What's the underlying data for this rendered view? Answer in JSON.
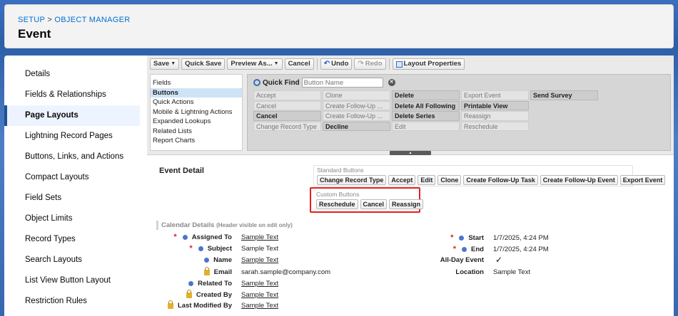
{
  "header": {
    "breadcrumb_setup": "SETUP",
    "breadcrumb_sep": " > ",
    "breadcrumb_object_manager": "OBJECT MANAGER",
    "title": "Event"
  },
  "sidebar": {
    "items": [
      {
        "label": "Details"
      },
      {
        "label": "Fields & Relationships"
      },
      {
        "label": "Page Layouts"
      },
      {
        "label": "Lightning Record Pages"
      },
      {
        "label": "Buttons, Links, and Actions"
      },
      {
        "label": "Compact Layouts"
      },
      {
        "label": "Field Sets"
      },
      {
        "label": "Object Limits"
      },
      {
        "label": "Record Types"
      },
      {
        "label": "Search Layouts"
      },
      {
        "label": "List View Button Layout"
      },
      {
        "label": "Restriction Rules"
      }
    ],
    "active_index": 2
  },
  "toolbar": {
    "save": "Save",
    "quick_save": "Quick Save",
    "preview_as": "Preview As...",
    "cancel": "Cancel",
    "undo": "Undo",
    "redo": "Redo",
    "layout_properties": "Layout Properties"
  },
  "palette": {
    "categories": [
      "Fields",
      "Buttons",
      "Quick Actions",
      "Mobile & Lightning Actions",
      "Expanded Lookups",
      "Related Lists",
      "Report Charts"
    ],
    "active_category": "Buttons",
    "quick_find_label": "Quick Find",
    "quick_find_placeholder": "Button Name",
    "clear": "✕",
    "grid": [
      [
        {
          "t": "Accept",
          "u": false
        },
        {
          "t": "Clone",
          "u": false
        },
        {
          "t": "Delete",
          "u": true
        },
        {
          "t": "Export Event",
          "u": false
        },
        {
          "t": "Send Survey",
          "u": true
        }
      ],
      [
        {
          "t": "Cancel",
          "u": false
        },
        {
          "t": "Create Follow-Up ...",
          "u": false
        },
        {
          "t": "Delete All Following",
          "u": true
        },
        {
          "t": "Printable View",
          "u": true
        },
        {
          "t": "",
          "u": false
        }
      ],
      [
        {
          "t": "Cancel",
          "u": true
        },
        {
          "t": "Create Follow-Up ...",
          "u": false
        },
        {
          "t": "Delete Series",
          "u": true
        },
        {
          "t": "Reassign",
          "u": false
        },
        {
          "t": "",
          "u": false
        }
      ],
      [
        {
          "t": "Change Record Type",
          "u": false
        },
        {
          "t": "Decline",
          "u": true
        },
        {
          "t": "Edit",
          "u": false
        },
        {
          "t": "Reschedule",
          "u": false
        },
        {
          "t": "",
          "u": false
        }
      ]
    ]
  },
  "layout": {
    "section_title": "Event Detail",
    "standard_buttons_label": "Standard Buttons",
    "standard_buttons": [
      "Change Record Type",
      "Accept",
      "Edit",
      "Clone",
      "Create Follow-Up Task",
      "Create Follow-Up Event",
      "Export Event"
    ],
    "custom_buttons_label": "Custom Buttons",
    "custom_buttons": [
      "Reschedule",
      "Cancel",
      "Reassign"
    ],
    "calendar_section": "Calendar Details",
    "calendar_hint": "(Header visible on edit only)",
    "left_fields": [
      {
        "label": "Assigned To",
        "value": "Sample Text",
        "link": true,
        "req": true,
        "icon": "dot"
      },
      {
        "label": "Subject",
        "value": "Sample Text",
        "link": false,
        "req": true,
        "icon": "dot"
      },
      {
        "label": "Name",
        "value": "Sample Text",
        "link": true,
        "req": false,
        "icon": "dot"
      },
      {
        "label": "Email",
        "value": "sarah.sample@company.com",
        "link": false,
        "req": false,
        "icon": "lock"
      },
      {
        "label": "Related To",
        "value": "Sample Text",
        "link": true,
        "req": false,
        "icon": "dot"
      },
      {
        "label": "Created By",
        "value": "Sample Text",
        "link": true,
        "req": false,
        "icon": "lock"
      },
      {
        "label": "Last Modified By",
        "value": "Sample Text",
        "link": true,
        "req": false,
        "icon": "lock"
      }
    ],
    "right_fields": [
      {
        "label": "Start",
        "value": "1/7/2025, 4:24 PM",
        "req": true,
        "icon": "dot"
      },
      {
        "label": "End",
        "value": "1/7/2025, 4:24 PM",
        "req": true,
        "icon": "dot"
      },
      {
        "label": "All-Day Event",
        "value": "✓",
        "req": false,
        "icon": "none"
      },
      {
        "label": "Location",
        "value": "Sample Text",
        "req": false,
        "icon": "none"
      }
    ]
  },
  "colors": {
    "background": "#2f5fa7",
    "active_accent": "#1b5297",
    "link": "#0070d2",
    "required": "#d4272b",
    "highlight_box": "#e0201f"
  }
}
